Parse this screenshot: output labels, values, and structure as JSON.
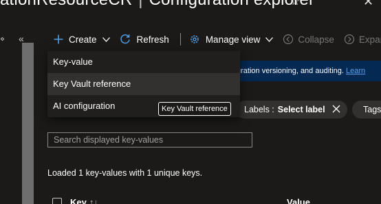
{
  "header": {
    "title_prefix": "ationResourceCR",
    "separator": "|",
    "title_suffix": "Configuration explorer"
  },
  "toolbar": {
    "create_label": "Create",
    "refresh_label": "Refresh",
    "manage_view_label": "Manage view",
    "collapse_label": "Collapse",
    "expand_label": "Expan"
  },
  "banner": {
    "text": "uration versioning, and auditing. ",
    "link": "Learn"
  },
  "create_menu": {
    "items": [
      {
        "label": "Key-value"
      },
      {
        "label": "Key Vault reference"
      },
      {
        "label": "AI configuration"
      }
    ],
    "hovered_index": 1
  },
  "tooltip": {
    "text": "Key Vault reference"
  },
  "filters": {
    "labels_prefix": "Labels :",
    "labels_value": "Select label",
    "tags_label": "Tags"
  },
  "search": {
    "placeholder": "Search displayed key-values",
    "value": ""
  },
  "status_text": "Loaded 1 key-values with 1 unique keys.",
  "table": {
    "columns": [
      {
        "label": "Key",
        "sort_icon": "↑↓"
      },
      {
        "label": "Value"
      }
    ]
  },
  "colors": {
    "background": "#1b1a19",
    "accent": "#4f9fe3",
    "banner": "#042952",
    "link": "#5ea0ef"
  }
}
